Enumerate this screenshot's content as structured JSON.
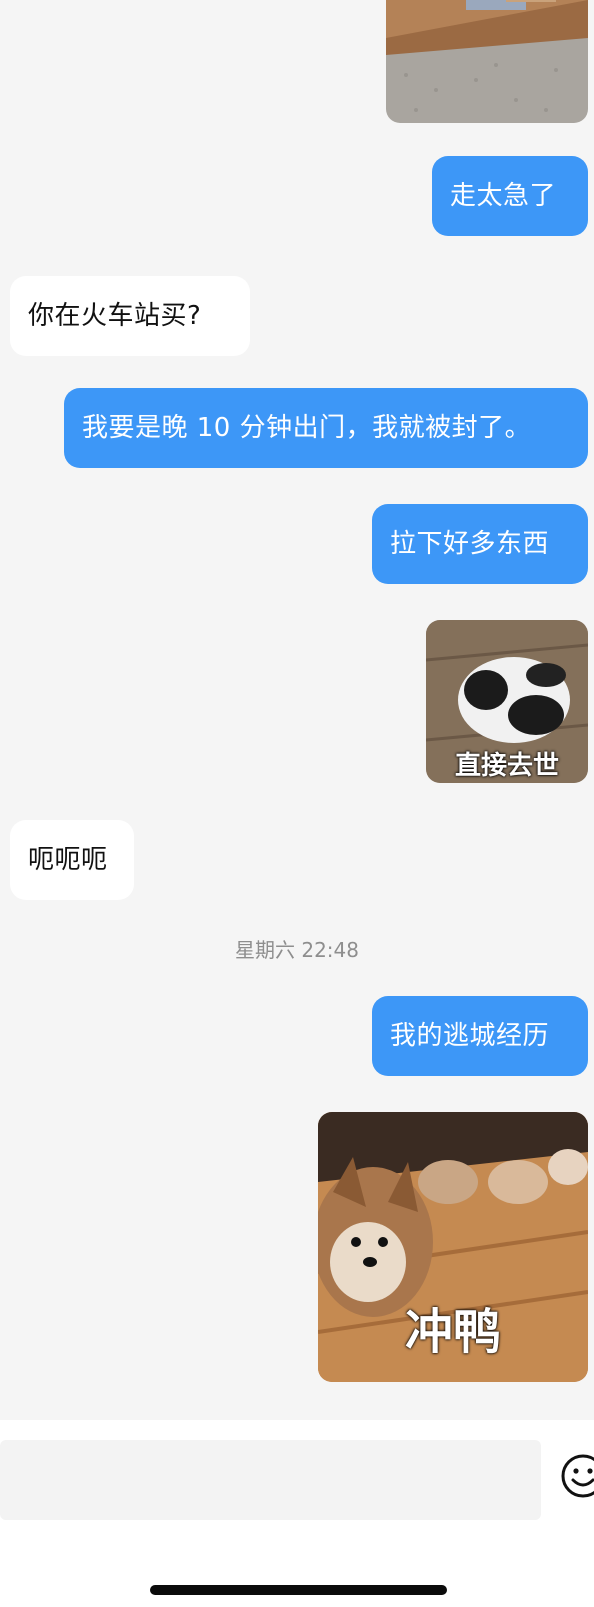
{
  "messages": {
    "m1_out": "走太急了",
    "m2_in": "你在火车站买?",
    "m3_out": "我要是晚 10 分钟出门，我就被封了。",
    "m4_out": "拉下好多东西",
    "sticker_panda_caption": "直接去世",
    "m5_in": "呃呃呃",
    "m6_out": "我的逃城经历",
    "sticker_corgi_caption": "冲鸭"
  },
  "timestamp": "星期六 22:48",
  "input": {
    "placeholder": "",
    "emoji_icon": "smiley-face-icon"
  },
  "colors": {
    "outgoing_bubble": "#3d97f7",
    "incoming_bubble": "#ffffff",
    "background": "#f5f5f5"
  }
}
